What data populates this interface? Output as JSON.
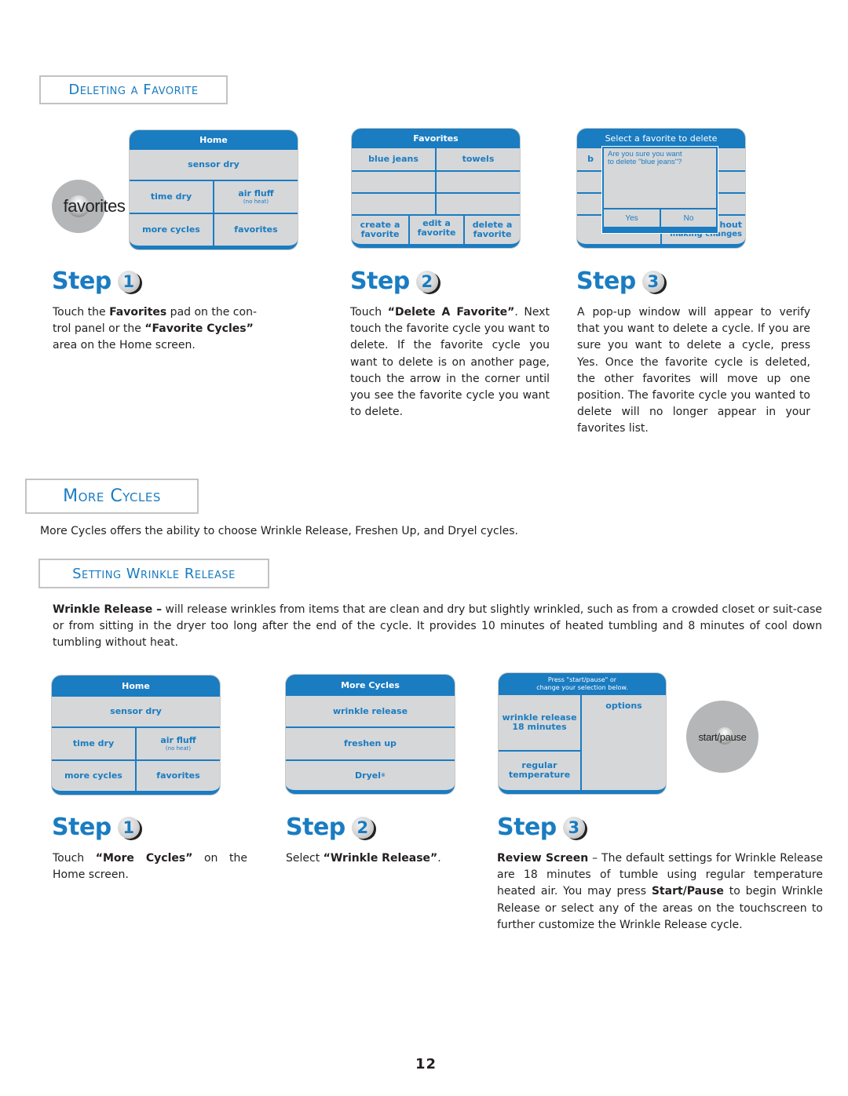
{
  "deleting_favorite": {
    "heading": "Deleting a Favorite",
    "favorites_button_label": "favorites",
    "screens": {
      "home": {
        "title": "Home",
        "sensor_dry": "sensor dry",
        "time_dry": "time dry",
        "air_fluff": "air fluff",
        "air_fluff_sub": "(no heat)",
        "more_cycles": "more cycles",
        "favorites": "favorites"
      },
      "favorites": {
        "title": "Favorites",
        "items": [
          "blue jeans",
          "towels",
          "",
          "",
          "",
          ""
        ],
        "create": [
          "create a",
          "favorite"
        ],
        "edit": [
          "edit a",
          "favorite"
        ],
        "delete": [
          "delete a",
          "favorite"
        ]
      },
      "delete_confirm": {
        "title": "Select a favorite to delete",
        "behind_left": "b",
        "behind_right_1": "hout",
        "behind_right_2": "making changes",
        "popup_line1": "Are you sure you want",
        "popup_line2": "to delete \"blue jeans\"?",
        "yes": "Yes",
        "no": "No"
      }
    },
    "steps": [
      {
        "word": "Step",
        "number": "1",
        "text_parts": [
          "Touch the ",
          "Favorites",
          " pad on the con-trol panel or the ",
          "“Favorite Cycles”",
          " area on the Home screen."
        ]
      },
      {
        "word": "Step",
        "number": "2",
        "text_parts": [
          "Touch ",
          "“Delete A Favorite”",
          ". Next touch the favorite cycle you want to delete.  If the favorite cycle you want to delete is on another page, touch the arrow in the corner until you see the favorite cycle you want to delete."
        ]
      },
      {
        "word": "Step",
        "number": "3",
        "text": "A pop-up window will appear to verify that you want to delete a cycle. If you are sure you want to delete a cycle, press Yes. Once the favorite cycle is deleted, the other favorites will move up one position. The favorite cycle you wanted to delete will no longer appear in your favorites list."
      }
    ]
  },
  "more_cycles": {
    "heading": "More Cycles",
    "intro": "More Cycles offers the ability to choose Wrinkle Release,  Freshen Up, and Dryel cycles."
  },
  "setting_wrinkle_release": {
    "heading": "Setting Wrinkle Release",
    "desc_bold": "Wrinkle Release –",
    "desc_text": " will release wrinkles from items that are clean and dry but slightly wrinkled, such as from a crowded closet or suit-case or from sitting in the dryer too long after the end of the cycle. It provides 10 minutes of heated tumbling and 8 minutes of cool down tumbling without heat.",
    "screens": {
      "home": {
        "title": "Home",
        "sensor_dry": "sensor dry",
        "time_dry": "time dry",
        "air_fluff": "air fluff",
        "air_fluff_sub": "(no heat)",
        "more_cycles": "more cycles",
        "favorites": "favorites"
      },
      "more_cycles": {
        "title": "More Cycles",
        "items": [
          "wrinkle release",
          "freshen up",
          "Dryel"
        ],
        "dryel_mark": "®"
      },
      "review": {
        "title_line1": "Press \"start/pause\" or",
        "title_line2": "change your selection below.",
        "cycle_line1": "wrinkle release",
        "cycle_line2": "18 minutes",
        "temp_line1": "regular",
        "temp_line2": "temperature",
        "options": "options"
      }
    },
    "start_pause_label": "start/pause",
    "steps": [
      {
        "word": "Step",
        "number": "1",
        "text_parts": [
          "Touch ",
          "“More Cycles”",
          " on the Home screen."
        ]
      },
      {
        "word": "Step",
        "number": "2",
        "text_parts": [
          "Select ",
          "“Wrinkle Release”",
          "."
        ]
      },
      {
        "word": "Step",
        "number": "3",
        "text_parts": [
          "Review Screen",
          " – The default settings for Wrinkle Release are 18 minutes of tumble using regular temperature heated air. You may press ",
          "Start/Pause",
          " to begin Wrinkle Release or select any of the areas on the touchscreen to further customize the Wrinkle Release cycle."
        ]
      }
    ]
  },
  "page_number": "12",
  "colors": {
    "accent_blue": "#1a7cc1",
    "panel_gray": "#d6d7d9",
    "text": "#231f20"
  }
}
